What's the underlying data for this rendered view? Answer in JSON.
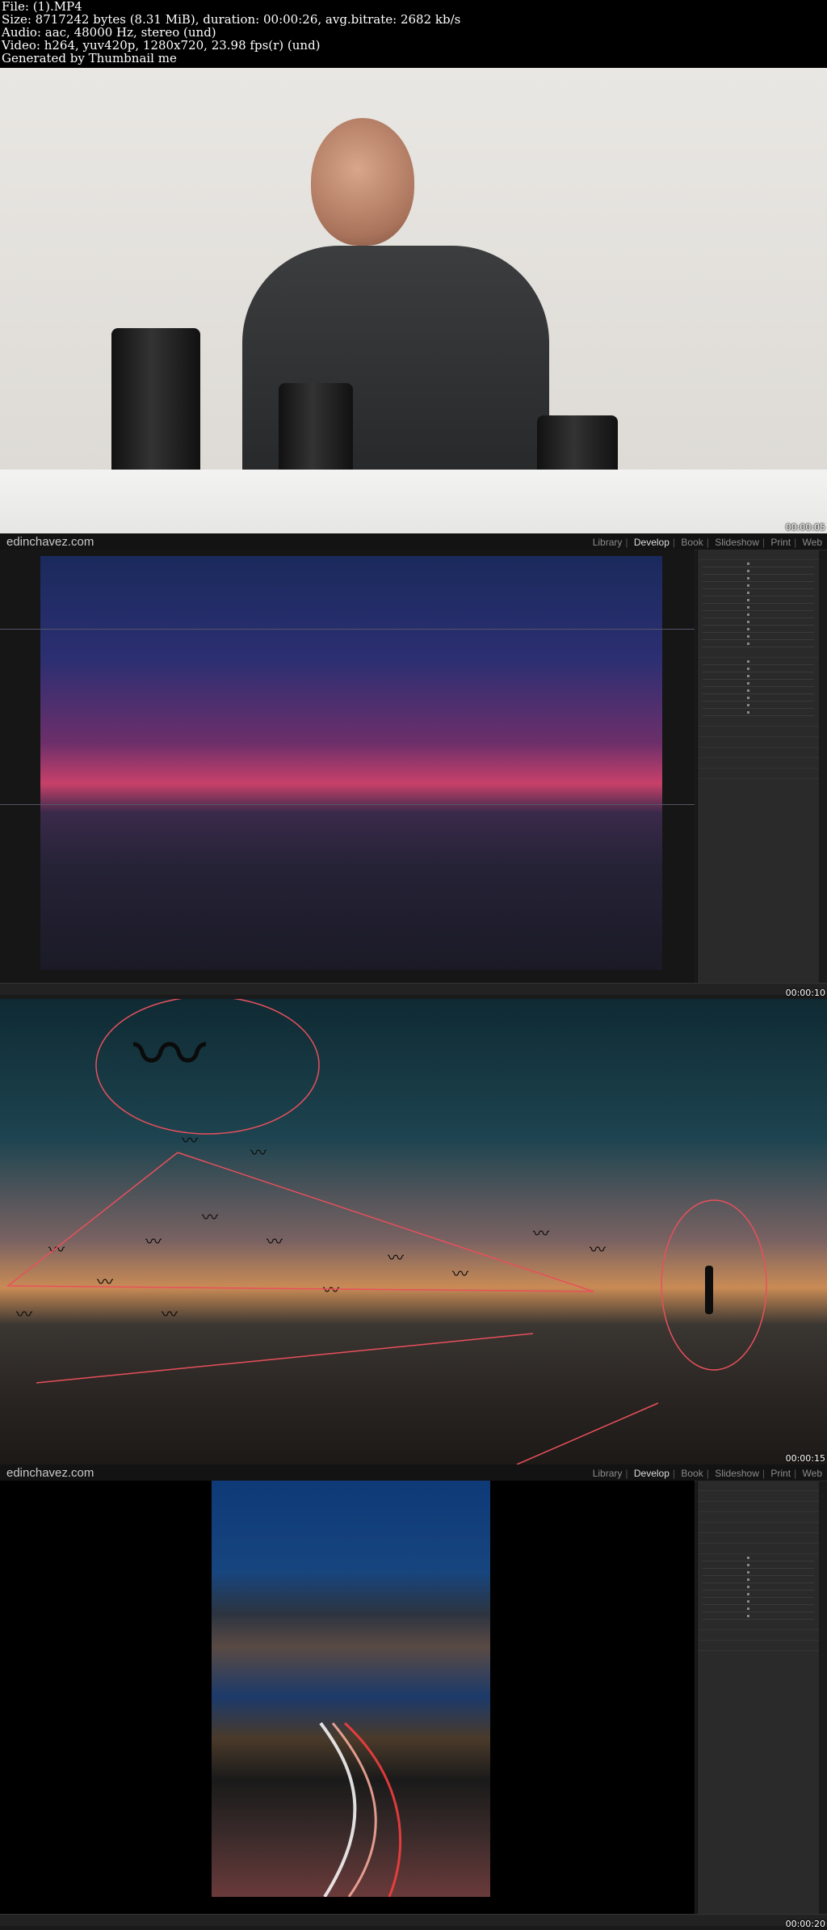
{
  "header": {
    "line1": "File: (1).MP4",
    "line2": "Size: 8717242 bytes (8.31 MiB), duration: 00:00:26, avg.bitrate: 2682 kb/s",
    "line3": "Audio: aac, 48000 Hz, stereo (und)",
    "line4": "Video: h264, yuv420p, 1280x720, 23.98 fps(r) (und)",
    "line5": "Generated by Thumbnail me"
  },
  "frames": [
    {
      "timestamp": "00:00:05"
    },
    {
      "timestamp": "00:00:10"
    },
    {
      "timestamp": "00:00:15"
    },
    {
      "timestamp": "00:00:20"
    }
  ],
  "lightroom": {
    "logo": "edinchavez.com",
    "modules": [
      "Library",
      "Develop",
      "Book",
      "Slideshow",
      "Print",
      "Web"
    ],
    "active_module": "Develop",
    "separator": "|"
  },
  "colors": {
    "annotation": "#e8505b",
    "lr_panel": "#2a2a2a",
    "lr_bg": "#161616"
  }
}
